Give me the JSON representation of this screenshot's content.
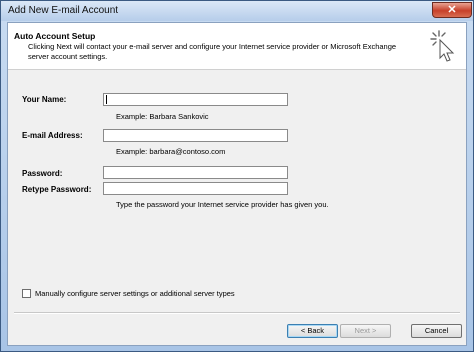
{
  "window": {
    "title": "Add New E-mail Account",
    "close_glyph": "✕"
  },
  "header": {
    "title": "Auto Account Setup",
    "description": "Clicking Next will contact your e-mail server and configure your Internet service provider or Microsoft Exchange server account settings.",
    "icon": "wizard-sparkle-cursor-icon"
  },
  "form": {
    "name_label": "Your Name:",
    "name_value": "",
    "name_hint": "Example: Barbara Sankovic",
    "email_label": "E-mail Address:",
    "email_value": "",
    "email_hint": "Example: barbara@contoso.com",
    "password_label": "Password:",
    "password_value": "",
    "retype_label": "Retype Password:",
    "retype_value": "",
    "password_hint": "Type the password your Internet service provider has given you."
  },
  "manual": {
    "label": "Manually configure server settings or additional server types",
    "checked": false
  },
  "buttons": {
    "back": "< Back",
    "next": "Next >",
    "cancel": "Cancel"
  }
}
